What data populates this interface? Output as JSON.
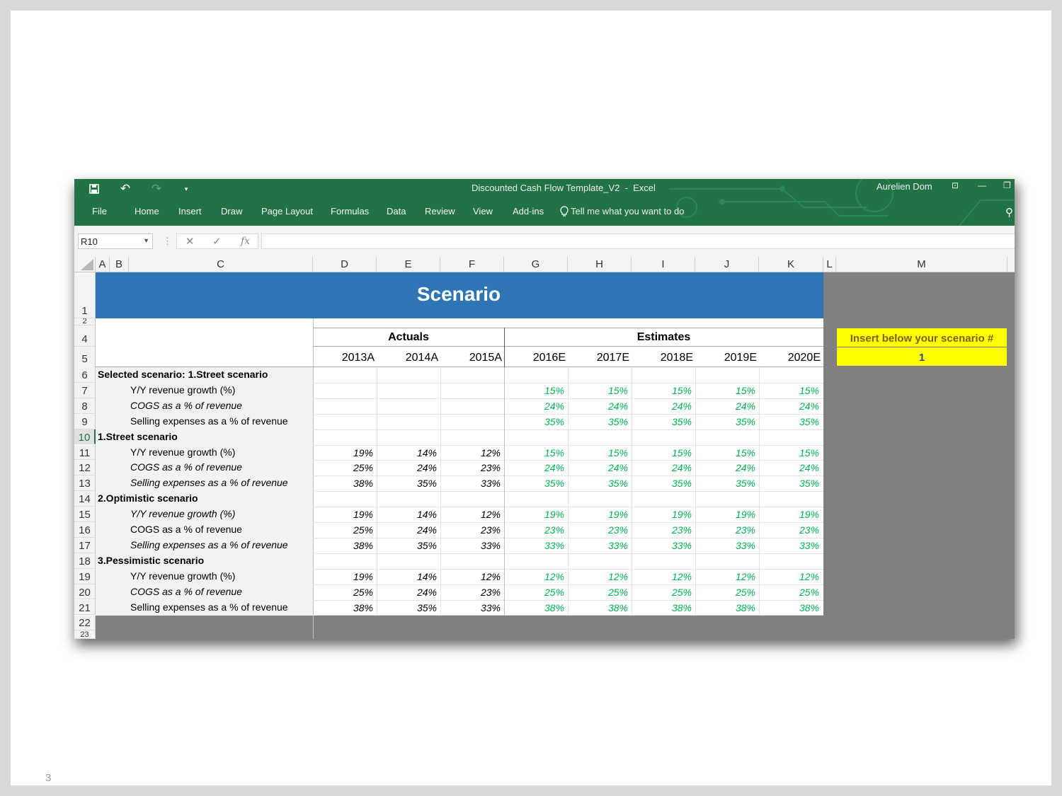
{
  "slide_number": "3",
  "window": {
    "title": "Discounted Cash Flow Template_V2",
    "title_sep": "-",
    "app": "Excel",
    "user": "Aurelien Dom",
    "accent": "#217346"
  },
  "ribbon_tabs": [
    "File",
    "Home",
    "Insert",
    "Draw",
    "Page Layout",
    "Formulas",
    "Data",
    "Review",
    "View",
    "Add-ins"
  ],
  "tell_me": "Tell me what you want to do",
  "formula_bar": {
    "name_box": "R10",
    "formula": "",
    "fx": "fx"
  },
  "columns": [
    "A",
    "B",
    "C",
    "D",
    "E",
    "F",
    "G",
    "H",
    "I",
    "J",
    "K",
    "L",
    "M"
  ],
  "sheet": {
    "banner_title": "Scenario",
    "banner_color": "#2e75b6",
    "actuals_label": "Actuals",
    "estimates_label": "Estimates",
    "years": [
      "2013A",
      "2014A",
      "2015A",
      "2016E",
      "2017E",
      "2018E",
      "2019E",
      "2020E"
    ],
    "input_box": {
      "label": "Insert below your scenario #",
      "value": "1",
      "color": "#ffff00"
    },
    "row_numbers": [
      "1",
      "2",
      "4",
      "5",
      "6",
      "7",
      "8",
      "9",
      "10",
      "11",
      "12",
      "13",
      "14",
      "15",
      "16",
      "17",
      "18",
      "19",
      "20",
      "21",
      "22",
      "23"
    ],
    "rows": [
      {
        "row": "6",
        "label": "Selected scenario: 1.Street scenario",
        "header": true
      },
      {
        "row": "7",
        "label": "Y/Y revenue growth (%)",
        "italic": false,
        "actuals": [
          "",
          "",
          ""
        ],
        "estimates": [
          "15%",
          "15%",
          "15%",
          "15%",
          "15%"
        ]
      },
      {
        "row": "8",
        "label": "COGS as a % of revenue",
        "italic": true,
        "actuals": [
          "",
          "",
          ""
        ],
        "estimates": [
          "24%",
          "24%",
          "24%",
          "24%",
          "24%"
        ]
      },
      {
        "row": "9",
        "label": "Selling expenses as a % of revenue",
        "italic": false,
        "actuals": [
          "",
          "",
          ""
        ],
        "estimates": [
          "35%",
          "35%",
          "35%",
          "35%",
          "35%"
        ]
      },
      {
        "row": "10",
        "label": "1.Street scenario",
        "header": true
      },
      {
        "row": "11",
        "label": "Y/Y revenue growth (%)",
        "italic": false,
        "actuals": [
          "19%",
          "14%",
          "12%"
        ],
        "estimates": [
          "15%",
          "15%",
          "15%",
          "15%",
          "15%"
        ]
      },
      {
        "row": "12",
        "label": "COGS as a % of revenue",
        "italic": true,
        "actuals": [
          "25%",
          "24%",
          "23%"
        ],
        "estimates": [
          "24%",
          "24%",
          "24%",
          "24%",
          "24%"
        ]
      },
      {
        "row": "13",
        "label": "Selling expenses as a % of revenue",
        "italic": true,
        "actuals": [
          "38%",
          "35%",
          "33%"
        ],
        "estimates": [
          "35%",
          "35%",
          "35%",
          "35%",
          "35%"
        ]
      },
      {
        "row": "14",
        "label": "2.Optimistic scenario",
        "header": true
      },
      {
        "row": "15",
        "label": "Y/Y revenue growth (%)",
        "italic": true,
        "actuals": [
          "19%",
          "14%",
          "12%"
        ],
        "estimates": [
          "19%",
          "19%",
          "19%",
          "19%",
          "19%"
        ]
      },
      {
        "row": "16",
        "label": "COGS as a % of revenue",
        "italic": false,
        "actuals": [
          "25%",
          "24%",
          "23%"
        ],
        "estimates": [
          "23%",
          "23%",
          "23%",
          "23%",
          "23%"
        ]
      },
      {
        "row": "17",
        "label": "Selling expenses as a % of revenue",
        "italic": true,
        "actuals": [
          "38%",
          "35%",
          "33%"
        ],
        "estimates": [
          "33%",
          "33%",
          "33%",
          "33%",
          "33%"
        ]
      },
      {
        "row": "18",
        "label": "3.Pessimistic scenario",
        "header": true
      },
      {
        "row": "19",
        "label": "Y/Y revenue growth (%)",
        "italic": false,
        "actuals": [
          "19%",
          "14%",
          "12%"
        ],
        "estimates": [
          "12%",
          "12%",
          "12%",
          "12%",
          "12%"
        ]
      },
      {
        "row": "20",
        "label": "COGS as a % of revenue",
        "italic": true,
        "actuals": [
          "25%",
          "24%",
          "23%"
        ],
        "estimates": [
          "25%",
          "25%",
          "25%",
          "25%",
          "25%"
        ]
      },
      {
        "row": "21",
        "label": "Selling expenses as a % of revenue",
        "italic": false,
        "actuals": [
          "38%",
          "35%",
          "33%"
        ],
        "estimates": [
          "38%",
          "38%",
          "38%",
          "38%",
          "38%"
        ]
      }
    ],
    "estimate_color": "#00b050"
  }
}
